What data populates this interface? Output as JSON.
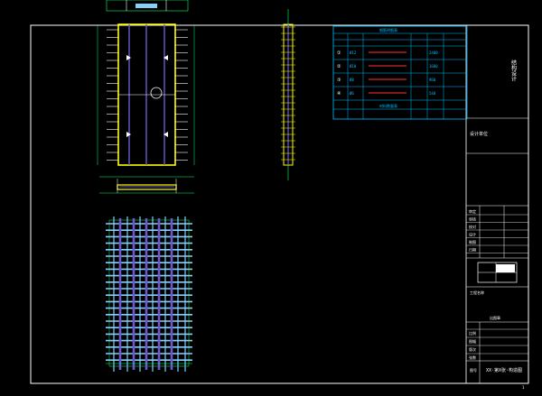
{
  "drawing": {
    "title_vertical": "结构设计",
    "sheet_title": "XX·第X张·构造图",
    "sheet_tag": "图号",
    "sheet_number": "1",
    "company_label": "设计单位",
    "project_label": "工程名称",
    "stamp_label": "出图章",
    "table_title": "钢筋明细表",
    "table_sub_title": "材料数量表",
    "rows": [
      {
        "id": "①",
        "a": "Ø12",
        "b": "2400"
      },
      {
        "id": "②",
        "a": "Ø10",
        "b": "1680"
      },
      {
        "id": "③",
        "a": "Ø8",
        "b": "960"
      },
      {
        "id": "④",
        "a": "Ø6",
        "b": "540"
      }
    ],
    "title_rows": [
      "审定",
      "审核",
      "校对",
      "设计",
      "制图",
      "日期"
    ],
    "bottom_rows": [
      "比例",
      "图幅",
      "版次",
      "张数"
    ]
  },
  "colors": {
    "background": "#000000",
    "frame": "#ffffff",
    "rebar_main": "#6a5acd",
    "rebar_dist": "#87cefa",
    "outline": "#ffff00",
    "table": "#00bfff",
    "dim": "#00ff66",
    "accent": "#ff3333"
  }
}
